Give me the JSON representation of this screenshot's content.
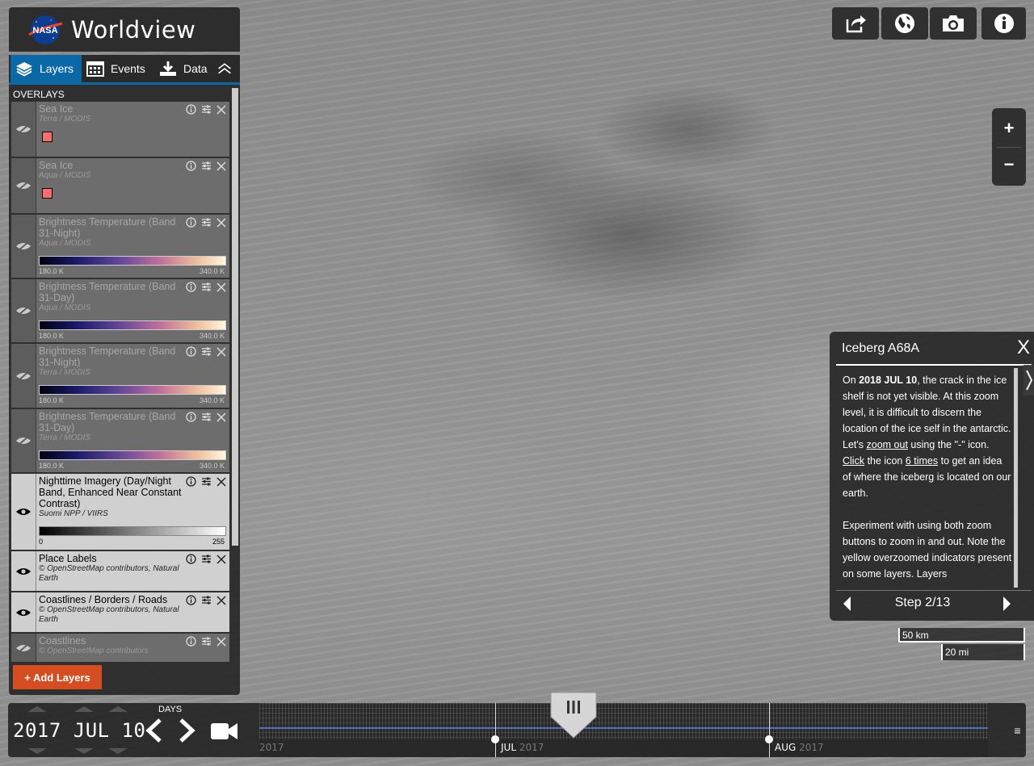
{
  "app": {
    "logo_text": "NASA",
    "title": "Worldview"
  },
  "tabs": [
    {
      "label": "Layers"
    },
    {
      "label": "Events"
    },
    {
      "label": "Data"
    }
  ],
  "overlays_heading": "OVERLAYS",
  "layers": [
    {
      "name": "Sea Ice",
      "source": "Terra / MODIS",
      "visible": false
    },
    {
      "name": "Sea Ice",
      "source": "Aqua / MODIS",
      "visible": false
    },
    {
      "name": "Brightness Temperature (Band 31-Night)",
      "source": "Aqua / MODIS",
      "visible": false,
      "range_min": "180.0 K",
      "range_max": "340.0 K"
    },
    {
      "name": "Brightness Temperature (Band 31-Day)",
      "source": "Aqua / MODIS",
      "visible": false,
      "range_min": "180.0 K",
      "range_max": "340.0 K"
    },
    {
      "name": "Brightness Temperature (Band 31-Night)",
      "source": "Terra / MODIS",
      "visible": false,
      "range_min": "180.0 K",
      "range_max": "340.0 K"
    },
    {
      "name": "Brightness Temperature (Band 31-Day)",
      "source": "Terra / MODIS",
      "visible": false,
      "range_min": "180.0 K",
      "range_max": "340.0 K"
    },
    {
      "name": "Nighttime Imagery (Day/Night Band, Enhanced Near Constant Contrast)",
      "source": "Suomi NPP / VIIRS",
      "visible": true,
      "range_min": "0",
      "range_max": "255"
    },
    {
      "name": "Place Labels",
      "source": "© OpenStreetMap contributors, Natural Earth",
      "visible": true
    },
    {
      "name": "Coastlines / Borders / Roads",
      "source": "© OpenStreetMap contributors, Natural Earth",
      "visible": true
    },
    {
      "name": "Coastlines",
      "source": "© OpenStreetMap contributors",
      "visible": false
    }
  ],
  "add_layers_label": "+ Add Layers",
  "toolbar": {
    "share_icon": "share-icon",
    "projection_icon": "globe-icon",
    "snapshot_icon": "camera-icon",
    "info_icon": "info-icon"
  },
  "zoom": {
    "in_label": "+",
    "out_label": "−"
  },
  "tour": {
    "title": "Iceberg A68A",
    "close": "X",
    "p1_pre": "On ",
    "p1_date": "2018 JUL 10",
    "p1_a": ", the crack in the ice shelf is not yet visible. At this zoom level, it is difficult to discern the location of the ice self in the antarctic. Let's ",
    "p1_link1": "zoom out",
    "p1_b": " using the \"-\" icon. ",
    "p1_link2": "Click",
    "p1_c": " the icon ",
    "p1_link3": "6 times",
    "p1_d": " to get an idea of where the iceberg is located on our earth.",
    "p2": "Experiment with using both zoom buttons to zoom in and out. Note the yellow overzoomed indicators present on some layers. Layers",
    "step": "Step 2/13"
  },
  "scale": {
    "km": "50 km",
    "mi": "20 mi"
  },
  "timeline": {
    "interval_label": "DAYS",
    "date": "2017 JUL 10",
    "axis_year_left": "2017",
    "months": [
      {
        "label": "JUL",
        "year": "2017"
      },
      {
        "label": "AUG",
        "year": "2017"
      }
    ],
    "menu_icon": "≡"
  },
  "colors": {
    "accent_blue": "#0a68a7",
    "add_button": "#d54e21",
    "swatch_red": "#ff6c6c"
  }
}
